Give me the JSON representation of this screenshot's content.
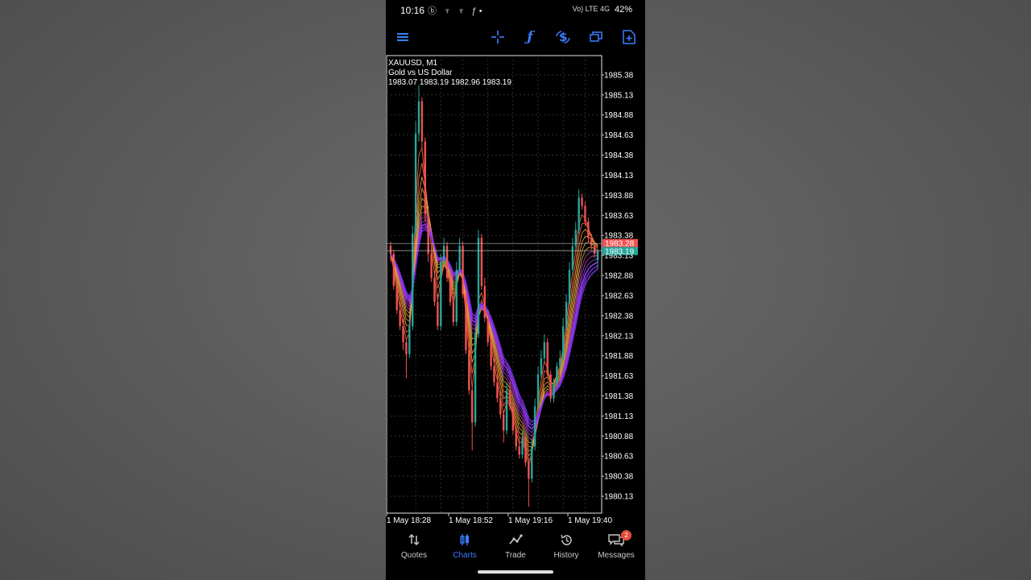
{
  "status_bar": {
    "time": "10:16",
    "notification_icons": "ⓑ ♆ ♆ ƒ•",
    "signal_text": "Vo) LTE 4G",
    "battery": "42%"
  },
  "toolbar": {
    "icons": [
      "menu-icon",
      "crosshair-icon",
      "indicators-icon",
      "symbol-icon",
      "timeframe-windows-icon",
      "new-order-icon"
    ],
    "accent": "#3d7dff"
  },
  "chart": {
    "symbol": "XAUUSD, M1",
    "description": "Gold vs US Dollar",
    "ohlc": "1983.07 1983.19 1982.96 1983.19"
  },
  "chart_data": {
    "type": "candlestick",
    "symbol": "XAUUSD",
    "timeframe": "M1",
    "y_ticks": [
      1985.38,
      1985.13,
      1984.88,
      1984.63,
      1984.38,
      1984.13,
      1983.88,
      1983.63,
      1983.38,
      1983.13,
      1982.88,
      1982.63,
      1982.38,
      1982.13,
      1981.88,
      1981.63,
      1981.38,
      1981.13,
      1980.88,
      1980.63,
      1980.38,
      1980.13
    ],
    "y_tick_labels": [
      "1985.38",
      "1985.13",
      "1984.88",
      "1984.63",
      "1984.38",
      "1984.13",
      "1983.88",
      "1983.63",
      "1983.38",
      "1983.13",
      "1982.88",
      "1982.63",
      "1982.38",
      "1982.13",
      "1981.88",
      "1981.63",
      "1981.38",
      "1981.13",
      "1980.88",
      "1980.63",
      "1980.38",
      "1980.13"
    ],
    "x_ticks": [
      "1 May 18:28",
      "1 May 18:52",
      "1 May 19:16",
      "1 May 19:40"
    ],
    "ask_label": "1983.28",
    "bid_label": "1983.19",
    "ask_price": 1983.28,
    "bid_price": 1983.19,
    "ylim": [
      1979.92,
      1985.62
    ],
    "up_color": "#26a69a",
    "down_color": "#ef5350",
    "ribbon_colors": [
      "#ff6a3d",
      "#ff9f40",
      "#e0b040",
      "#c040c0",
      "#9c40ff",
      "#7a30e0"
    ],
    "closes": [
      1983.15,
      1982.75,
      1982.45,
      1982.25,
      1982.05,
      1981.9,
      1982.25,
      1983.4,
      1984.65,
      1985.05,
      1984.55,
      1983.65,
      1983.15,
      1982.85,
      1982.55,
      1982.25,
      1983.05,
      1983.25,
      1982.85,
      1982.55,
      1982.3,
      1982.95,
      1983.25,
      1982.65,
      1981.95,
      1981.45,
      1981.05,
      1982.15,
      1983.35,
      1982.75,
      1982.35,
      1982.05,
      1981.75,
      1981.55,
      1981.35,
      1981.15,
      1980.95,
      1981.45,
      1981.25,
      1980.95,
      1980.75,
      1980.65,
      1980.85,
      1980.55,
      1980.35,
      1980.75,
      1981.25,
      1981.65,
      1981.85,
      1982.05,
      1981.65,
      1981.35,
      1981.55,
      1981.75,
      1981.85,
      1982.25,
      1982.55,
      1982.95,
      1983.25,
      1983.45,
      1983.85,
      1983.75,
      1983.55,
      1983.35,
      1983.25,
      1983.15,
      1983.19
    ],
    "opens": [
      1983.25,
      1983.15,
      1982.75,
      1982.45,
      1982.25,
      1982.05,
      1981.9,
      1982.25,
      1983.4,
      1984.65,
      1985.05,
      1984.55,
      1983.65,
      1983.15,
      1982.85,
      1982.55,
      1982.25,
      1983.05,
      1983.25,
      1982.85,
      1982.55,
      1982.3,
      1982.95,
      1983.25,
      1982.65,
      1981.95,
      1981.45,
      1981.05,
      1982.15,
      1983.35,
      1982.75,
      1982.35,
      1982.05,
      1981.75,
      1981.55,
      1981.35,
      1981.15,
      1980.95,
      1981.45,
      1981.25,
      1980.95,
      1980.75,
      1980.65,
      1980.85,
      1980.55,
      1980.35,
      1980.75,
      1981.25,
      1981.65,
      1981.85,
      1982.05,
      1981.65,
      1981.35,
      1981.55,
      1981.75,
      1981.85,
      1982.25,
      1982.55,
      1982.95,
      1983.25,
      1983.45,
      1983.85,
      1983.75,
      1983.55,
      1983.35,
      1983.25,
      1983.07
    ],
    "highs": [
      1983.3,
      1983.2,
      1982.8,
      1982.55,
      1982.35,
      1982.1,
      1982.35,
      1983.5,
      1984.8,
      1985.25,
      1985.1,
      1984.6,
      1983.75,
      1983.25,
      1982.95,
      1982.65,
      1983.15,
      1983.35,
      1983.3,
      1982.95,
      1982.6,
      1983.05,
      1983.35,
      1983.3,
      1982.7,
      1982.05,
      1981.5,
      1982.25,
      1983.45,
      1983.4,
      1982.85,
      1982.45,
      1982.1,
      1981.85,
      1981.65,
      1981.45,
      1981.2,
      1981.55,
      1981.55,
      1981.3,
      1981.0,
      1980.85,
      1980.95,
      1980.9,
      1980.6,
      1980.85,
      1981.35,
      1981.75,
      1981.95,
      1982.15,
      1982.1,
      1981.7,
      1981.6,
      1981.8,
      1981.95,
      1982.35,
      1982.65,
      1983.05,
      1983.35,
      1983.55,
      1983.95,
      1983.9,
      1983.8,
      1983.6,
      1983.4,
      1983.3,
      1983.21
    ],
    "lows": [
      1983.05,
      1982.7,
      1982.4,
      1982.2,
      1981.95,
      1981.6,
      1981.85,
      1982.2,
      1983.35,
      1984.55,
      1984.45,
      1983.55,
      1983.05,
      1982.8,
      1982.5,
      1982.2,
      1982.2,
      1983.0,
      1982.8,
      1982.5,
      1982.25,
      1982.25,
      1982.9,
      1982.6,
      1981.9,
      1981.4,
      1980.7,
      1981.0,
      1982.1,
      1982.7,
      1982.3,
      1982.0,
      1981.7,
      1981.5,
      1981.3,
      1981.1,
      1980.8,
      1980.9,
      1981.2,
      1980.9,
      1980.7,
      1980.6,
      1980.6,
      1980.5,
      1980.0,
      1980.3,
      1980.7,
      1981.2,
      1981.6,
      1981.8,
      1981.6,
      1981.3,
      1981.3,
      1981.5,
      1981.7,
      1981.8,
      1982.2,
      1982.5,
      1982.9,
      1983.2,
      1983.4,
      1983.7,
      1983.5,
      1983.3,
      1983.2,
      1983.1,
      1982.96
    ]
  },
  "bottom_nav": {
    "items": [
      {
        "label": "Quotes",
        "icon": "quotes-icon"
      },
      {
        "label": "Charts",
        "icon": "charts-icon"
      },
      {
        "label": "Trade",
        "icon": "trade-icon"
      },
      {
        "label": "History",
        "icon": "history-icon"
      },
      {
        "label": "Messages",
        "icon": "messages-icon"
      }
    ],
    "messages_badge": "2",
    "active_color": "#3d7dff"
  }
}
